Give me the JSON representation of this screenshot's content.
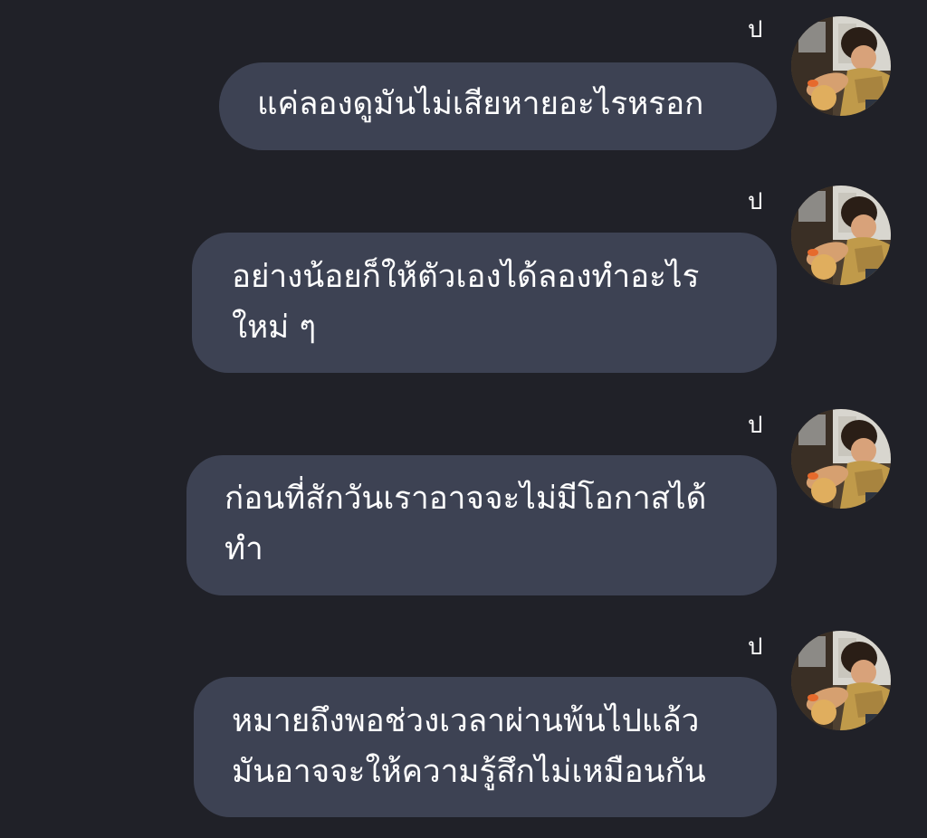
{
  "messages": [
    {
      "sender": "ป",
      "text": "แค่ลองดูมันไม่เสียหายอะไรหรอก"
    },
    {
      "sender": "ป",
      "text": "อย่างน้อยก็ให้ตัวเองได้ลองทำอะไร\nใหม่ ๆ"
    },
    {
      "sender": "ป",
      "text": "ก่อนที่สักวันเราอาจจะไม่มีโอกาสได้\nทำ"
    },
    {
      "sender": "ป",
      "text": "หมายถึงพอช่วงเวลาผ่านพ้นไปแล้ว\nมันอาจจะให้ความรู้สึกไม่เหมือนกัน"
    }
  ],
  "avatar_icon": "profile-photo",
  "colors": {
    "background": "#202128",
    "bubble": "#3d4253",
    "text": "#ffffff"
  }
}
